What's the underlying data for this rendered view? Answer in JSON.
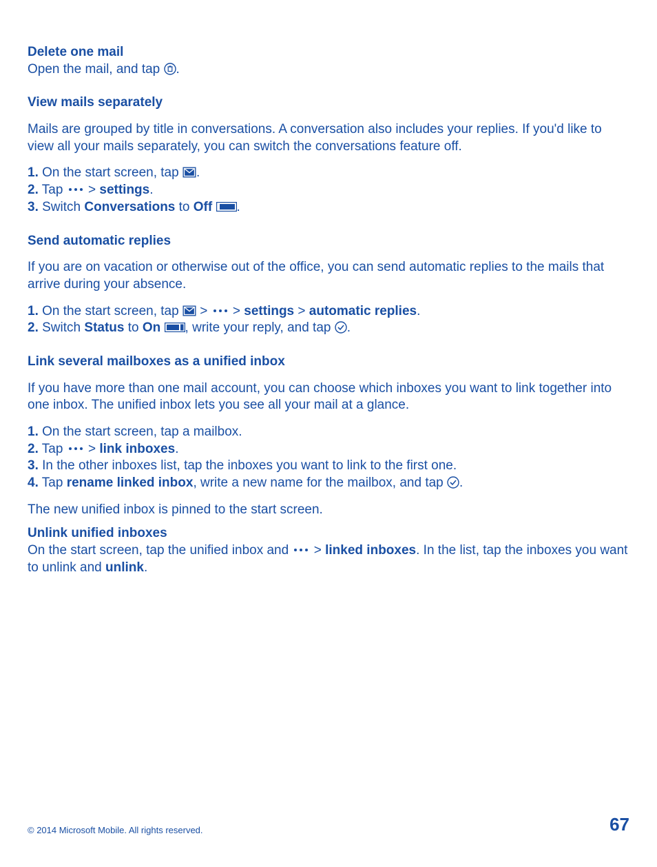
{
  "s1": {
    "heading": "Delete one mail",
    "line1a": "Open the mail, and tap ",
    "line1b": "."
  },
  "s2": {
    "heading": "View mails separately",
    "intro": "Mails are grouped by title in conversations. A conversation also includes your replies. If you'd like to view all your mails separately, you can switch the conversations feature off.",
    "st1n": "1.",
    "st1a": " On the start screen, tap ",
    "st1b": ".",
    "st2n": "2.",
    "st2a": " Tap ",
    "st2gt": " > ",
    "st2settings": "settings",
    "st2b": ".",
    "st3n": "3.",
    "st3a": " Switch ",
    "st3conv": "Conversations",
    "st3b": " to ",
    "st3off": "Off",
    "st3sp": " ",
    "st3c": "."
  },
  "s3": {
    "heading": "Send automatic replies",
    "intro": "If you are on vacation or otherwise out of the office, you can send automatic replies to the mails that arrive during your absence.",
    "st1n": "1.",
    "st1a": " On the start screen, tap ",
    "st1gt1": " > ",
    "st1gt2": " > ",
    "st1settings": "settings",
    "st1gt3": " > ",
    "st1auto": "automatic replies",
    "st1b": ".",
    "st2n": "2.",
    "st2a": " Switch ",
    "st2status": "Status",
    "st2b": " to ",
    "st2on": "On",
    "st2sp": " ",
    "st2c": ", write your reply, and tap ",
    "st2d": "."
  },
  "s4": {
    "heading": "Link several mailboxes as a unified inbox",
    "intro": "If you have more than one mail account, you can choose which inboxes you want to link together into one inbox. The unified inbox lets you see all your mail at a glance.",
    "st1n": "1.",
    "st1a": " On the start screen, tap a mailbox.",
    "st2n": "2.",
    "st2a": " Tap ",
    "st2gt": " > ",
    "st2link": "link inboxes",
    "st2b": ".",
    "st3n": "3.",
    "st3a": " In the other inboxes list, tap the inboxes you want to link to the first one.",
    "st4n": "4.",
    "st4a": " Tap ",
    "st4rename": "rename linked inbox",
    "st4b": ", write a new name for the mailbox, and tap ",
    "st4c": ".",
    "after": "The new unified inbox is pinned to the start screen."
  },
  "s5": {
    "heading": "Unlink unified inboxes",
    "line_a": "On the start screen, tap the unified inbox and ",
    "line_gt": " > ",
    "line_linked": "linked inboxes",
    "line_b": ". In the list, tap the inboxes you want to unlink and ",
    "line_unlink": "unlink",
    "line_c": "."
  },
  "footer": {
    "copyright": "© 2014 Microsoft Mobile. All rights reserved.",
    "page": "67"
  }
}
